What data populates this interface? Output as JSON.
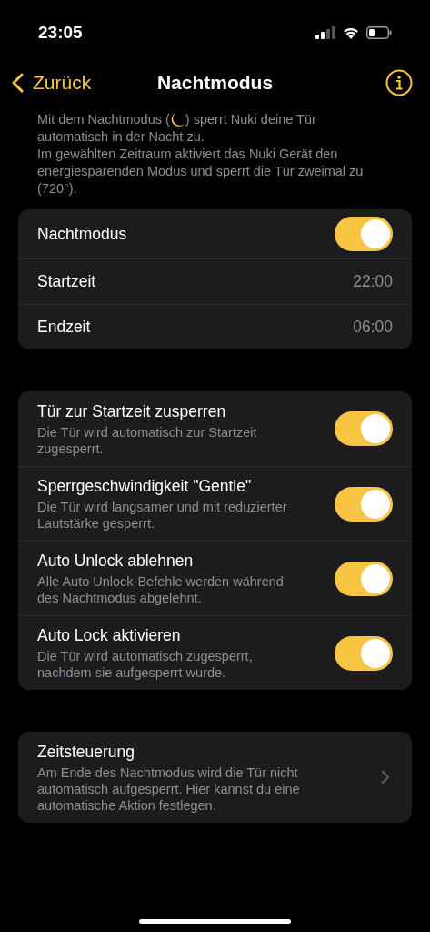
{
  "status_bar": {
    "time": "23:05"
  },
  "nav": {
    "back_label": "Zurück",
    "title": "Nachtmodus"
  },
  "intro": {
    "before": "Mit dem Nachtmodus (",
    "after": ") sperrt Nuki deine Tür",
    "line_2": "automatisch in der Nacht zu.",
    "paragraph_2": "Im gewählten Zeitraum aktiviert das Nuki Gerät den energiesparenden Modus und sperrt die Tür zweimal zu (720°)."
  },
  "main_settings": [
    {
      "kind": "toggle",
      "label": "Nachtmodus",
      "on": true
    },
    {
      "kind": "value",
      "label": "Startzeit",
      "value": "22:00"
    },
    {
      "kind": "value",
      "label": "Endzeit",
      "value": "06:00"
    }
  ],
  "options": [
    {
      "title": "Tür zur Startzeit zusperren",
      "description": "Die Tür wird automatisch zur Startzeit zugesperrt.",
      "on": true
    },
    {
      "title": "Sperrgeschwindigkeit \"Gentle\"",
      "description": "Die Tür wird langsamer und mit reduzierter Lautstärke gesperrt.",
      "on": true
    },
    {
      "title": "Auto Unlock ablehnen",
      "description": "Alle Auto Unlock-Befehle werden während des Nachtmodus abgelehnt.",
      "on": true
    },
    {
      "title": "Auto Lock aktivieren",
      "description": "Die Tür wird automatisch zugesperrt, nachdem sie aufgesperrt wurde.",
      "on": true
    }
  ],
  "schedule": {
    "title": "Zeitsteuerung",
    "description": "Am Ende des Nachtmodus wird die Tür nicht automatisch aufgesperrt. Hier kannst du eine automatische Aktion festlegen."
  }
}
